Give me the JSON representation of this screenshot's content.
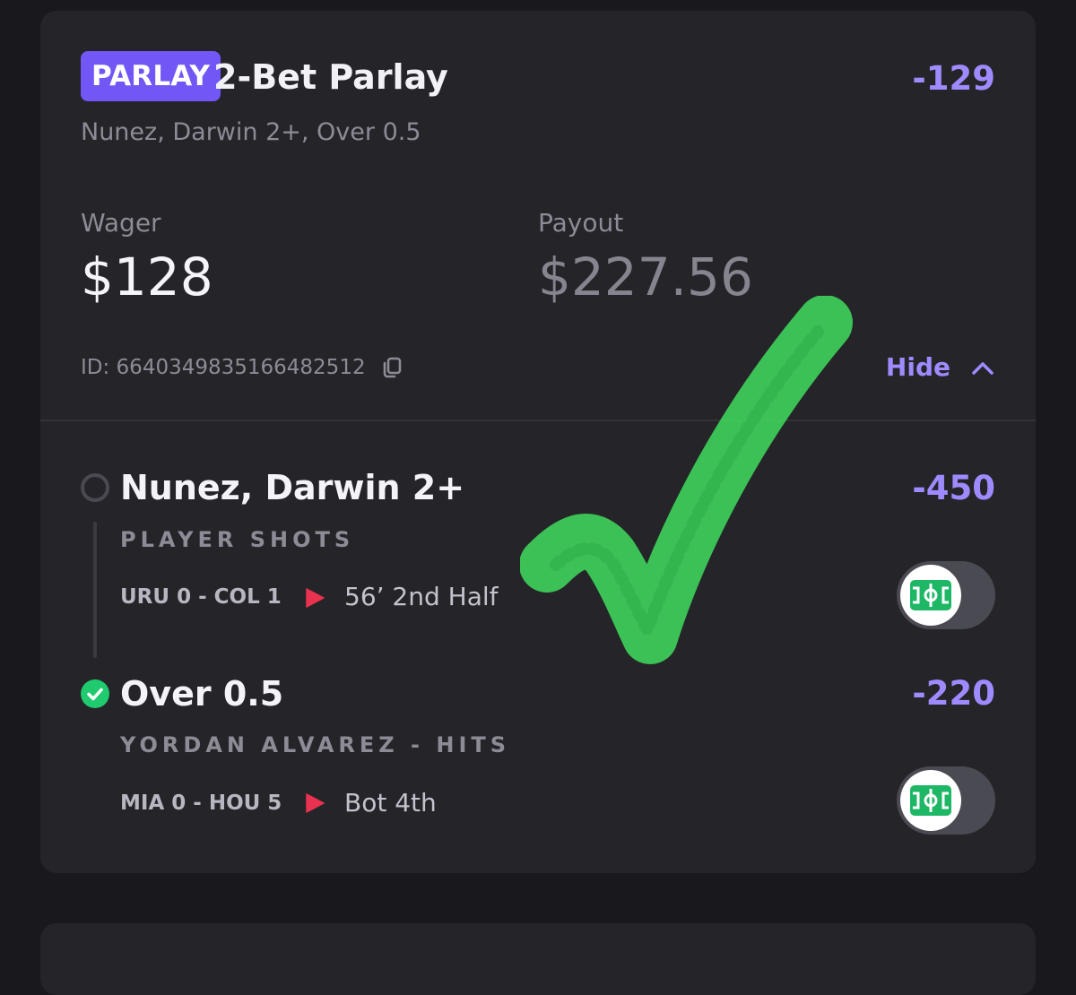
{
  "bet": {
    "badge": "PARLAY",
    "title": "2-Bet Parlay",
    "odds": "-129",
    "subtitle": "Nunez, Darwin 2+, Over 0.5",
    "wager_label": "Wager",
    "wager_value": "$128",
    "payout_label": "Payout",
    "payout_value": "$227.56",
    "id_text": "ID: 6640349835166482512",
    "hide_label": "Hide"
  },
  "legs": [
    {
      "status": "pending",
      "name": "Nunez, Darwin 2+",
      "odds": "-450",
      "market": "PLAYER SHOTS",
      "score": "URU 0 - COL 1",
      "game_time": "56’  2nd Half"
    },
    {
      "status": "won",
      "name": "Over 0.5",
      "odds": "-220",
      "market": "YORDAN ALVAREZ - HITS",
      "score": "MIA 0 - HOU 5",
      "game_time": "Bot 4th"
    }
  ],
  "colors": {
    "accent": "#9f8bff",
    "badge": "#7357f6",
    "won": "#1fcb6e",
    "live": "#e8324f",
    "check_overlay": "#3ed35a"
  },
  "icons": {
    "copy": "copy-icon",
    "chevron": "chevron-up-icon",
    "live": "play-triangle-icon",
    "field": "soccer-field-icon"
  }
}
